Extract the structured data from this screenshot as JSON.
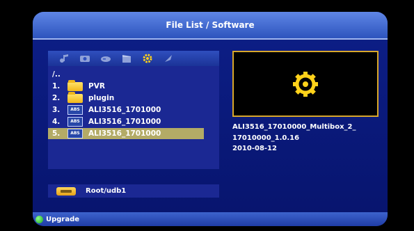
{
  "window": {
    "title": "File List / Software"
  },
  "iconbar": {
    "icons": [
      "music-icon",
      "photo-icon",
      "game-icon",
      "movie-icon",
      "software-icon",
      "recycle-icon"
    ],
    "selected_index": 4
  },
  "file_list": {
    "parent": "/..",
    "items": [
      {
        "num": "1.",
        "type": "folder",
        "name": "PVR"
      },
      {
        "num": "2.",
        "type": "folder",
        "name": "plugin"
      },
      {
        "num": "3.",
        "type": "abs",
        "name": "ALI3516_1701000"
      },
      {
        "num": "4.",
        "type": "abs",
        "name": "ALI3516_1701000"
      },
      {
        "num": "5.",
        "type": "abs",
        "name": "ALI3516_1701000"
      }
    ],
    "selected_index": 4,
    "abs_badge": "ABS"
  },
  "path": {
    "label": "Root/udb1"
  },
  "preview": {
    "icon": "gear-icon"
  },
  "file_info": {
    "line1": "ALI3516_17010000_Multibox_2_",
    "line2": "17010000_1.0.16",
    "date": "2010-08-12"
  },
  "footer": {
    "action_label": "Upgrade",
    "action_color": "green"
  },
  "colors": {
    "accent": "#d8a72a",
    "selection": "#b3ab66",
    "background": "#0d1f88",
    "title": "#3b62cf"
  }
}
